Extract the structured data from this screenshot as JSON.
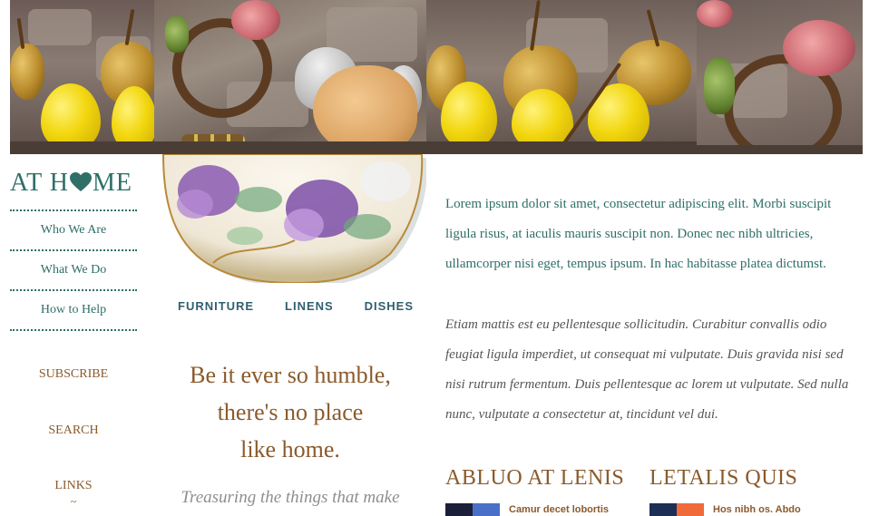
{
  "logo": {
    "before": "AT H",
    "after": "ME",
    "heart_color": "#2f6f68"
  },
  "nav": {
    "items": [
      {
        "label": "Who We Are"
      },
      {
        "label": "What We Do"
      },
      {
        "label": "How to Help"
      }
    ]
  },
  "sidebar_links": {
    "subscribe": "SUBSCRIBE",
    "search": "SEARCH",
    "links": "LINKS",
    "links_ornament": "~"
  },
  "categories": [
    "FURNITURE",
    "LINENS",
    "DISHES"
  ],
  "motto": {
    "line1": "Be it ever so humble,",
    "line2": "there's no place",
    "line3": "like home.",
    "tagline": "Treasuring the things that make"
  },
  "content": {
    "paragraph1": "Lorem ipsum dolor sit amet, consectetur adipiscing elit. Morbi suscipit ligula risus, at iaculis mauris suscipit non. Donec nec nibh ultricies, ullamcorper nisi eget, tempus ipsum. In hac habitasse platea dictumst.",
    "paragraph2": "Etiam mattis est eu pellentesque sollicitudin. Curabitur convallis odio feugiat ligula imperdiet, ut consequat mi vulputate. Duis gravida nisi sed nisi rutrum fermentum. Duis pellentesque ac lorem ut vulputate. Sed nulla nunc, vulputate a consectetur at, tincidunt vel dui."
  },
  "sections": [
    {
      "heading": "ABLUO AT LENIS",
      "item_link": "Camur decet lobortis"
    },
    {
      "heading": "LETALIS QUIS",
      "item_link": "Hos nibh os. Abdo"
    }
  ],
  "colors": {
    "teal": "#2f6f68",
    "brown": "#8b5a2b",
    "gray_text": "#555555",
    "category_blue": "#2f5f70"
  }
}
